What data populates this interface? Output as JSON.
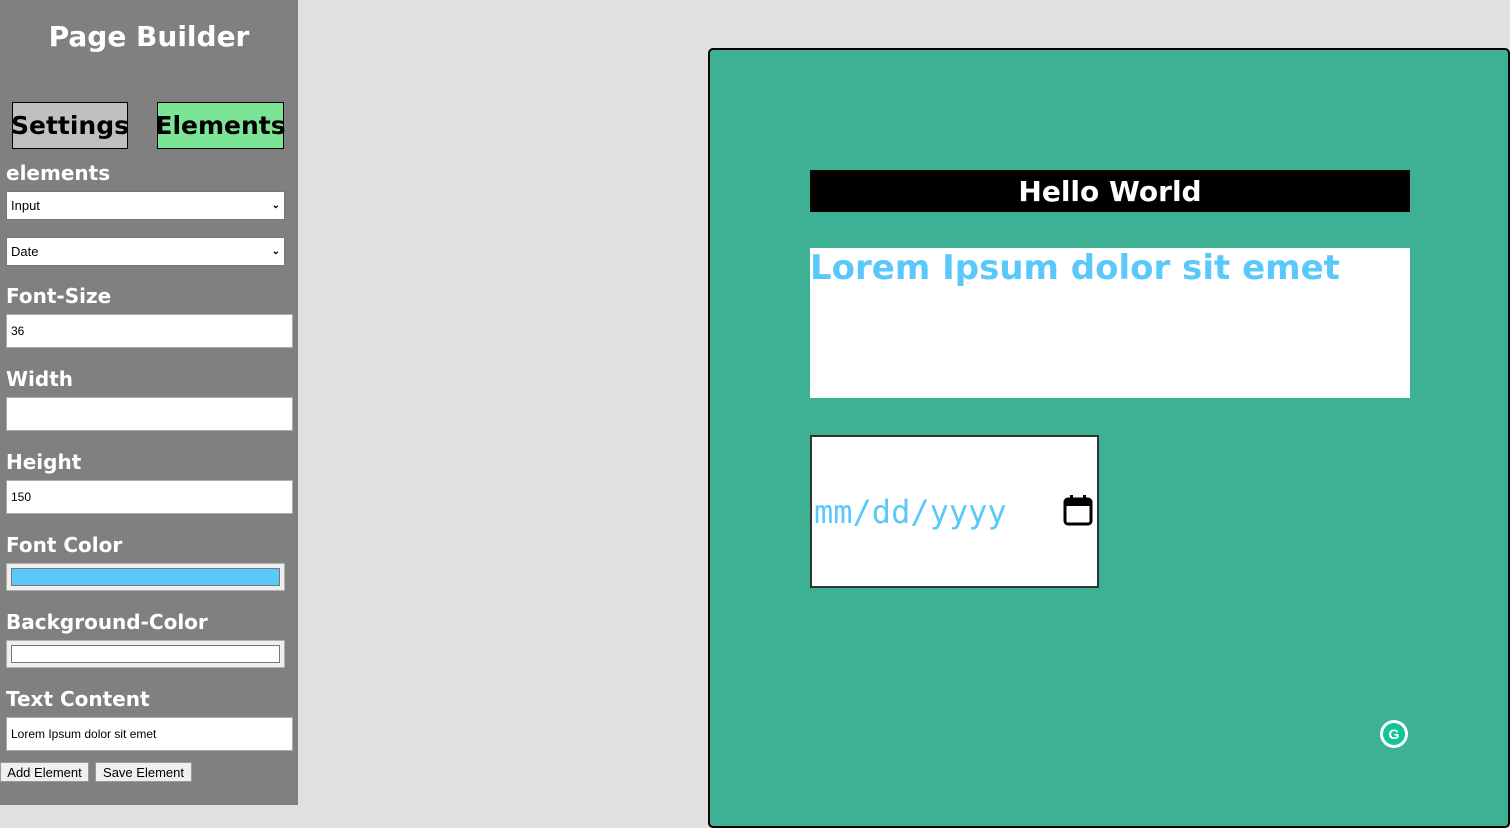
{
  "sidebar": {
    "title": "Page Builder",
    "tabs": {
      "settings": "Settings",
      "elements": "Elements"
    },
    "elements_label": "elements",
    "element_type_select": "Input",
    "input_type_select": "Date",
    "font_size": {
      "label": "Font-Size",
      "value": "36"
    },
    "width": {
      "label": "Width",
      "value": ""
    },
    "height": {
      "label": "Height",
      "value": "150"
    },
    "font_color": {
      "label": "Font Color",
      "value": "#5bc8fb"
    },
    "background_color": {
      "label": "Background-Color",
      "value": "#ffffff"
    },
    "text_content": {
      "label": "Text Content",
      "value": "Lorem Ipsum dolor sit emet"
    },
    "buttons": {
      "add": "Add Element",
      "save": "Save Element"
    }
  },
  "canvas": {
    "background": "#3eb194",
    "heading_text": "Hello World",
    "paragraph_text": "Lorem Ipsum dolor sit emet",
    "date_placeholder": "mm/dd/yyyy",
    "date_icon": "calendar-icon",
    "grammarly_icon": "grammarly-icon"
  }
}
